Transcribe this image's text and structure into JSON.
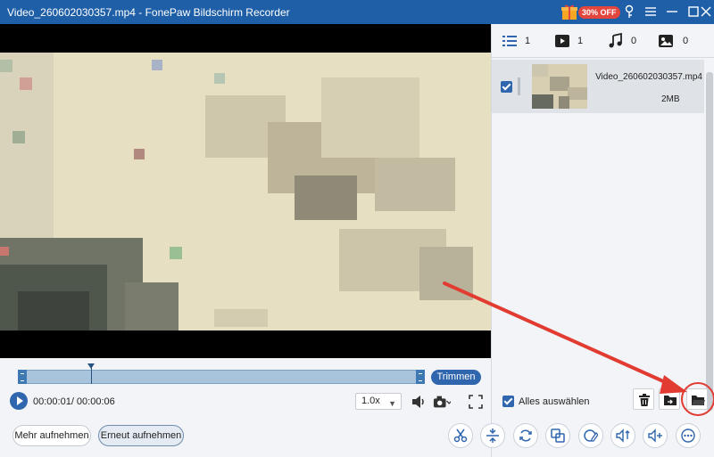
{
  "window": {
    "title": "Video_260602030357.mp4 - FonePaw Bildschirm Recorder",
    "promo_badge": "30% OFF"
  },
  "player": {
    "time": "00:00:01/ 00:00:06",
    "speed": "1.0x",
    "trim_label": "Trimmen",
    "progress": 0.18
  },
  "buttons": {
    "record_more": "Mehr aufnehmen",
    "record_again": "Erneut aufnehmen"
  },
  "tabs": [
    {
      "name": "all",
      "icon": "list-icon",
      "count": "1"
    },
    {
      "name": "video",
      "icon": "video-icon",
      "count": "1"
    },
    {
      "name": "audio",
      "icon": "music-icon",
      "count": "0"
    },
    {
      "name": "image",
      "icon": "image-icon",
      "count": "0"
    }
  ],
  "files": [
    {
      "name": "Video_260602030357.mp4",
      "size": "2MB",
      "checked": true
    }
  ],
  "list_footer": {
    "select_all_label": "Alles auswählen"
  },
  "tools": [
    "scissors-icon",
    "compress-icon",
    "rotate-icon",
    "merge-icon",
    "edit-icon",
    "volume-icon",
    "audio-add-icon",
    "more-icon"
  ],
  "colors": {
    "titlebar": "#1f5fa8",
    "accent": "#2f66ad",
    "highlight": "#e13b32"
  }
}
